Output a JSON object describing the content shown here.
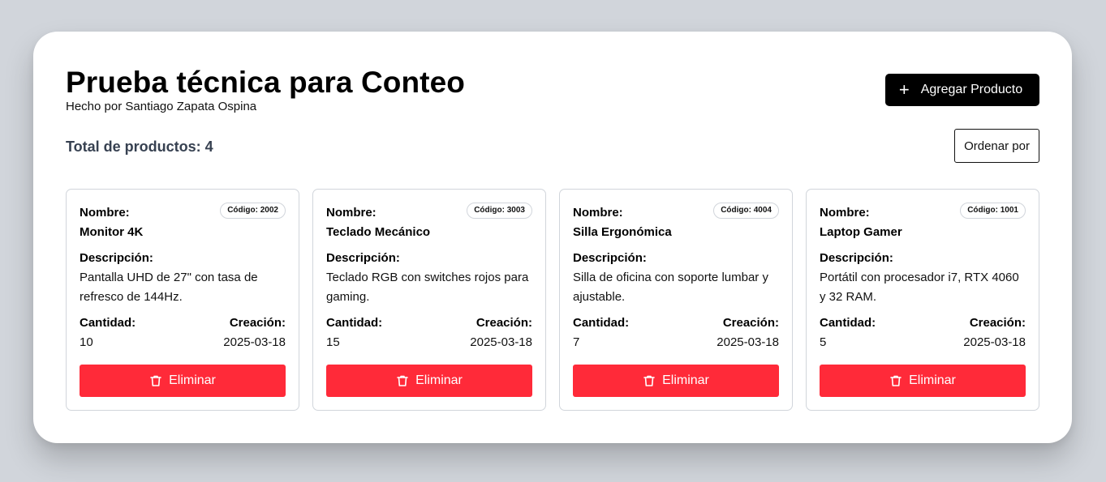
{
  "header": {
    "title": "Prueba técnica para Conteo",
    "subtitle": "Hecho por Santiago Zapata Ospina",
    "add_button_label": "Agregar Producto",
    "add_icon": "plus-icon"
  },
  "toolbar": {
    "total_text": "Total de productos: 4",
    "sort_button_label": "Ordenar por"
  },
  "labels": {
    "name": "Nombre:",
    "description": "Descripción:",
    "quantity": "Cantidad:",
    "created": "Creación:",
    "delete": "Eliminar",
    "delete_icon": "trash-icon"
  },
  "products": [
    {
      "code": "Código: 2002",
      "name": "Monitor 4K",
      "description": "Pantalla UHD de 27\" con tasa de refresco de 144Hz.",
      "quantity": "10",
      "created": "2025-03-18"
    },
    {
      "code": "Código: 3003",
      "name": "Teclado Mecánico",
      "description": "Teclado RGB con switches rojos para gaming.",
      "quantity": "15",
      "created": "2025-03-18"
    },
    {
      "code": "Código: 4004",
      "name": "Silla Ergonómica",
      "description": "Silla de oficina con soporte lumbar y ajustable.",
      "quantity": "7",
      "created": "2025-03-18"
    },
    {
      "code": "Código: 1001",
      "name": "Laptop Gamer",
      "description": "Portátil con procesador i7, RTX 4060 y 32 RAM.",
      "quantity": "5",
      "created": "2025-03-18"
    }
  ],
  "colors": {
    "background": "#d1d5db",
    "panel": "#ffffff",
    "primary_button": "#000000",
    "danger_button": "#ff2a39"
  }
}
